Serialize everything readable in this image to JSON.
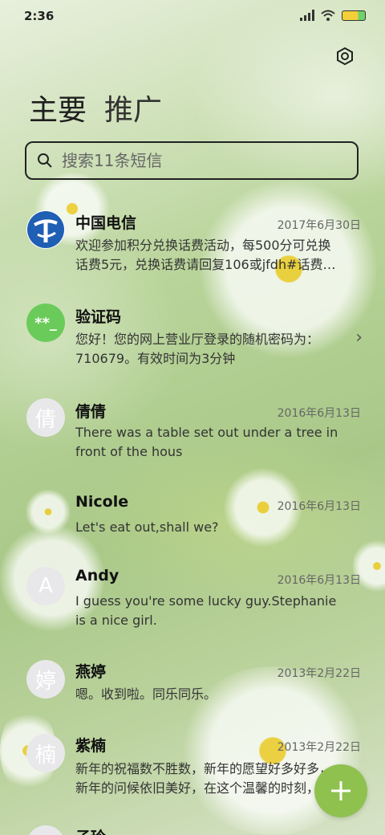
{
  "status_bar": {
    "time": "2:36"
  },
  "tabs": [
    {
      "label": "主要"
    },
    {
      "label": "推广"
    }
  ],
  "search": {
    "placeholder": "搜索11条短信"
  },
  "conversations": [
    {
      "name": "中国电信",
      "date": "2017年6月30日",
      "preview": "欢迎参加积分兑换话费活动，每500分可兑换\n话费5元，兑换话费请回复106或jfdh#话费…",
      "avatar_type": "logo"
    },
    {
      "name": "验证码",
      "date": "",
      "preview": "您好！您的网上营业厅登录的随机密码为：\n710679。有效时间为3分钟",
      "avatar_text": "**_",
      "avatar_color": "#6bcb5a"
    },
    {
      "name": "倩倩",
      "date": "2016年6月13日",
      "preview": "There was a table set out under a tree in\nfront of the hous",
      "avatar_text": "倩"
    },
    {
      "name": "Nicole",
      "date": "2016年6月13日",
      "preview": "Let's eat out,shall we?",
      "avatar_text": ""
    },
    {
      "name": "Andy",
      "date": "2016年6月13日",
      "preview": "I guess you're some lucky guy.Stephanie\nis a nice girl.",
      "avatar_text": "A"
    },
    {
      "name": "燕婷",
      "date": "2013年2月22日",
      "preview": "嗯。收到啦。同乐同乐。",
      "avatar_text": "婷"
    },
    {
      "name": "紫楠",
      "date": "2013年2月22日",
      "preview": "新年的祝福数不胜数，新年的愿望好多好多，\n新年的问候依旧美好，在这个温馨的时刻，",
      "avatar_text": "楠"
    },
    {
      "name": "子玲",
      "date": "",
      "preview": "",
      "avatar_text": ""
    }
  ],
  "colors": {
    "fab": "#8fc14f",
    "verification_avatar": "#6bcb5a",
    "telecom_blue": "#1f5fb4"
  },
  "icons": {
    "settings": "settings-hexagon-icon",
    "search": "search-icon",
    "fab": "plus-icon",
    "chevron": "chevron-right-icon"
  }
}
